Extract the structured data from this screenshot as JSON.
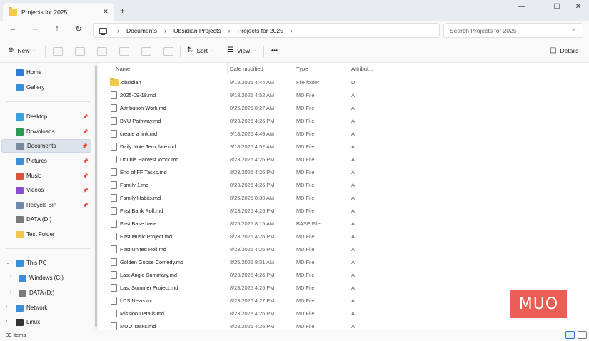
{
  "window": {
    "tab_title": "Projects for 2025",
    "new_tab_glyph": "+",
    "close_tab_glyph": "✕",
    "minimize_glyph": "—",
    "maximize_glyph": "☐",
    "close_glyph": "✕"
  },
  "nav": {
    "back_glyph": "←",
    "forward_glyph": "→",
    "up_glyph": "↑",
    "refresh_glyph": "↻",
    "breadcrumbs": [
      "Documents",
      "Obsidian Projects",
      "Projects for 2025"
    ],
    "breadcrumb_sep": "›",
    "search_placeholder": "Search Projects for 2025",
    "search_glyph": "⌕"
  },
  "toolbar": {
    "new_label": "New",
    "new_glyph": "⊕",
    "sort_label": "Sort",
    "sort_glyph": "⇅",
    "view_label": "View",
    "view_glyph": "☰",
    "more_glyph": "•••",
    "details_label": "Details",
    "details_glyph": "◫",
    "caret_glyph": "⌄"
  },
  "sidebar": {
    "pin_glyph": "📌",
    "items": [
      {
        "label": "Home",
        "color": "#2e7bd6",
        "pinned": false
      },
      {
        "label": "Gallery",
        "color": "#3a8fd9",
        "pinned": false
      },
      {
        "label": "Desktop",
        "color": "#3aa0e0",
        "pinned": true
      },
      {
        "label": "Downloads",
        "color": "#2d9a55",
        "pinned": true
      },
      {
        "label": "Documents",
        "color": "#7a8aa0",
        "pinned": true
      },
      {
        "label": "Pictures",
        "color": "#3a8fd9",
        "pinned": true
      },
      {
        "label": "Music",
        "color": "#d9563a",
        "pinned": true
      },
      {
        "label": "Videos",
        "color": "#8a4fd0",
        "pinned": true
      },
      {
        "label": "Recycle Bin",
        "color": "#6d8aa8",
        "pinned": true
      },
      {
        "label": "DATA (D:)",
        "color": "#7a7a7a",
        "pinned": false
      },
      {
        "label": "Test Folder",
        "color": "#f2c94c",
        "pinned": false
      },
      {
        "label": "This PC",
        "color": "#3a8fd9",
        "pinned": false
      },
      {
        "label": "Windows (C:)",
        "color": "#3a8fd9",
        "pinned": false
      },
      {
        "label": "DATA (D:)",
        "color": "#7a7a7a",
        "pinned": false
      },
      {
        "label": "Network",
        "color": "#3a8fd9",
        "pinned": false
      },
      {
        "label": "Linux",
        "color": "#333333",
        "pinned": false
      }
    ]
  },
  "columns": {
    "name": "Name",
    "date": "Date modified",
    "type": "Type",
    "attr": "Attribut..."
  },
  "files": [
    {
      "name": ".obsidian",
      "date": "9/18/2025 4:44 AM",
      "type": "File folder",
      "attr": "D",
      "folder": true
    },
    {
      "name": "2025-09-18.md",
      "date": "9/18/2025 4:52 AM",
      "type": "MD File",
      "attr": "A"
    },
    {
      "name": "Attribution Work.md",
      "date": "8/25/2025 8:27 AM",
      "type": "MD File",
      "attr": "A"
    },
    {
      "name": "BYU Pathway.md",
      "date": "8/23/2025 4:26 PM",
      "type": "MD File",
      "attr": "A"
    },
    {
      "name": "create a link.md",
      "date": "9/18/2025 4:49 AM",
      "type": "MD File",
      "attr": "A"
    },
    {
      "name": "Daily Note Template.md",
      "date": "9/18/2025 4:52 AM",
      "type": "MD File",
      "attr": "A"
    },
    {
      "name": "Double Harvest Work.md",
      "date": "8/23/2025 4:26 PM",
      "type": "MD File",
      "attr": "A"
    },
    {
      "name": "End of FF Tasks.md",
      "date": "8/23/2025 4:26 PM",
      "type": "MD File",
      "attr": "A"
    },
    {
      "name": "Family 1.md",
      "date": "8/23/2025 4:26 PM",
      "type": "MD File",
      "attr": "A"
    },
    {
      "name": "Family Habits.md",
      "date": "8/25/2025 8:30 AM",
      "type": "MD File",
      "attr": "A"
    },
    {
      "name": "First Bank Roll.md",
      "date": "8/23/2025 4:26 PM",
      "type": "MD File",
      "attr": "A"
    },
    {
      "name": "First Base.base",
      "date": "8/25/2025 8:15 AM",
      "type": "BASE File",
      "attr": "A"
    },
    {
      "name": "First Music Project.md",
      "date": "8/23/2025 4:26 PM",
      "type": "MD File",
      "attr": "A"
    },
    {
      "name": "First United Roll.md",
      "date": "8/23/2025 4:26 PM",
      "type": "MD File",
      "attr": "A"
    },
    {
      "name": "Golden Goose Comedy.md",
      "date": "8/25/2025 8:31 AM",
      "type": "MD File",
      "attr": "A"
    },
    {
      "name": "Last Angle Summary.md",
      "date": "8/23/2025 4:26 PM",
      "type": "MD File",
      "attr": "A"
    },
    {
      "name": "Last Summer Project.md",
      "date": "8/23/2025 4:26 PM",
      "type": "MD File",
      "attr": "A"
    },
    {
      "name": "LDS News.md",
      "date": "8/23/2025 4:27 PM",
      "type": "MD File",
      "attr": "A"
    },
    {
      "name": "Mission Details.md",
      "date": "8/23/2025 4:26 PM",
      "type": "MD File",
      "attr": "A"
    },
    {
      "name": "MUO Tasks.md",
      "date": "8/23/2025 4:26 PM",
      "type": "MD File",
      "attr": "A"
    }
  ],
  "status": {
    "item_count": "39 items"
  },
  "watermark": {
    "text": "MUO"
  }
}
